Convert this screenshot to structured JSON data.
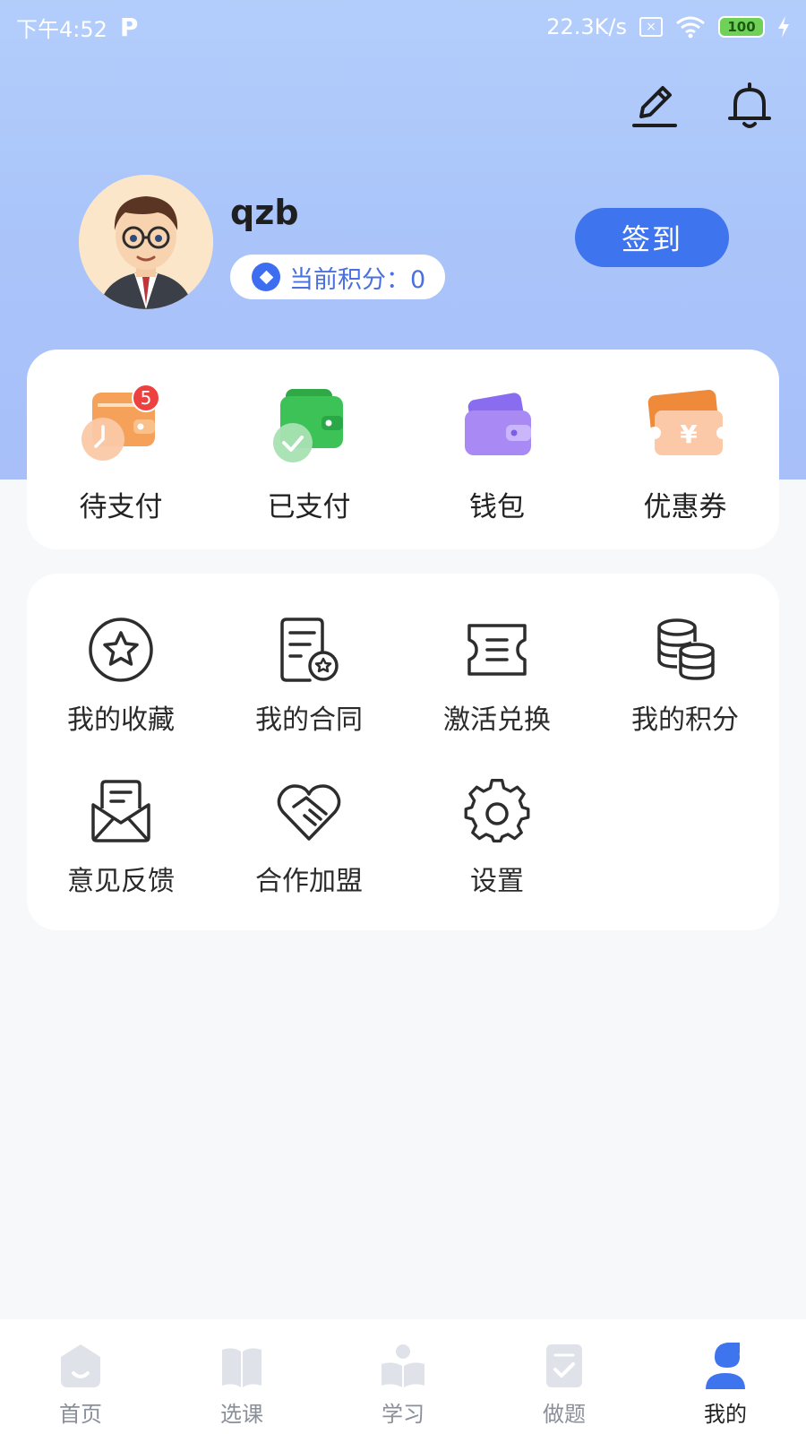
{
  "status_bar": {
    "time": "下午4:52",
    "app_badge": "P",
    "net_speed": "22.3K/s",
    "sim": "×",
    "battery": "100"
  },
  "profile": {
    "username": "qzb",
    "points_label": "当前积分：0",
    "checkin_label": "签到"
  },
  "payments": {
    "items": [
      {
        "label": "待支付",
        "icon": "pending-payment-icon",
        "badge": "5"
      },
      {
        "label": "已支付",
        "icon": "paid-icon"
      },
      {
        "label": "钱包",
        "icon": "wallet-icon"
      },
      {
        "label": "优惠券",
        "icon": "coupon-icon"
      }
    ]
  },
  "tools": {
    "items": [
      {
        "label": "我的收藏",
        "icon": "star-icon"
      },
      {
        "label": "我的合同",
        "icon": "contract-icon"
      },
      {
        "label": "激活兑换",
        "icon": "ticket-icon"
      },
      {
        "label": "我的积分",
        "icon": "coins-icon"
      },
      {
        "label": "意见反馈",
        "icon": "mail-icon"
      },
      {
        "label": "合作加盟",
        "icon": "handshake-heart-icon"
      },
      {
        "label": "设置",
        "icon": "gear-icon"
      }
    ]
  },
  "nav": {
    "items": [
      {
        "label": "首页",
        "icon": "home-icon"
      },
      {
        "label": "选课",
        "icon": "book-icon"
      },
      {
        "label": "学习",
        "icon": "reader-icon"
      },
      {
        "label": "做题",
        "icon": "quiz-icon"
      },
      {
        "label": "我的",
        "icon": "profile-icon",
        "active": true
      }
    ]
  },
  "colors": {
    "accent": "#3f74ef",
    "header_gradient_top": "#b3cdfb",
    "header_gradient_bottom": "#a8bffa",
    "badge_red": "#ef4040"
  }
}
